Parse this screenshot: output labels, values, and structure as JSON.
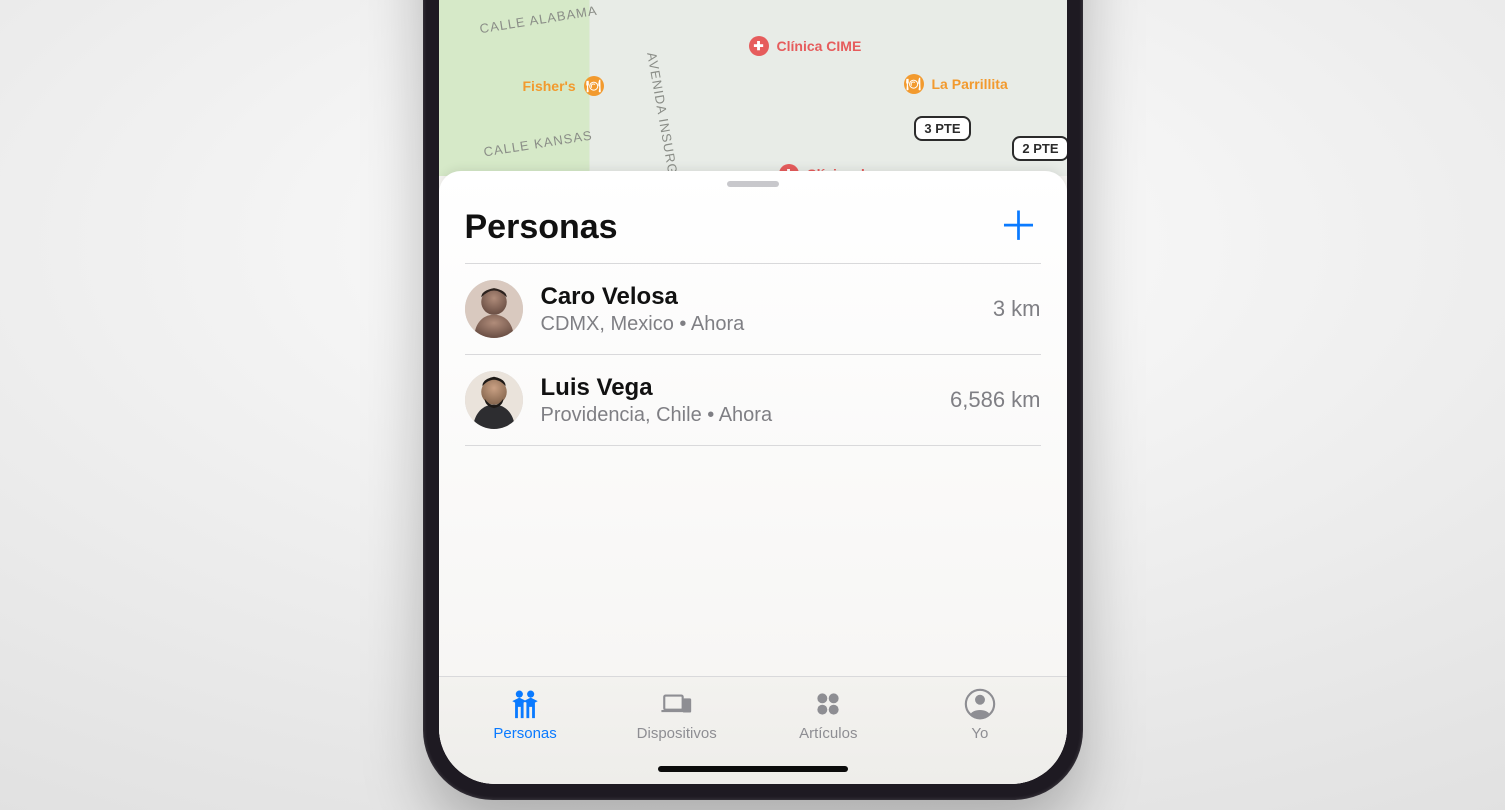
{
  "sheet": {
    "title": "Personas",
    "add_glyph": "＋"
  },
  "people": [
    {
      "name": "Caro Velosa",
      "subtitle": "CDMX, Mexico • Ahora",
      "distance": "3 km"
    },
    {
      "name": "Luis Vega",
      "subtitle": "Providencia, Chile • Ahora",
      "distance": "6,586 km"
    }
  ],
  "tabs": {
    "personas": "Personas",
    "dispositivos": "Dispositivos",
    "articulos": "Artículos",
    "yo": "Yo"
  },
  "map": {
    "streets": {
      "alabama": "CALLE ALABAMA",
      "kansas": "CALLE KANSAS",
      "insurgentes": "AVENIDA INSURGENTES"
    },
    "poi": {
      "fishers": "Fisher's",
      "cime": "Clínica CIME",
      "parrillita": "La Parrillita",
      "clinica2": "Clínica de"
    },
    "routes": {
      "r1": "3 PTE",
      "r2": "2 PTE"
    }
  }
}
